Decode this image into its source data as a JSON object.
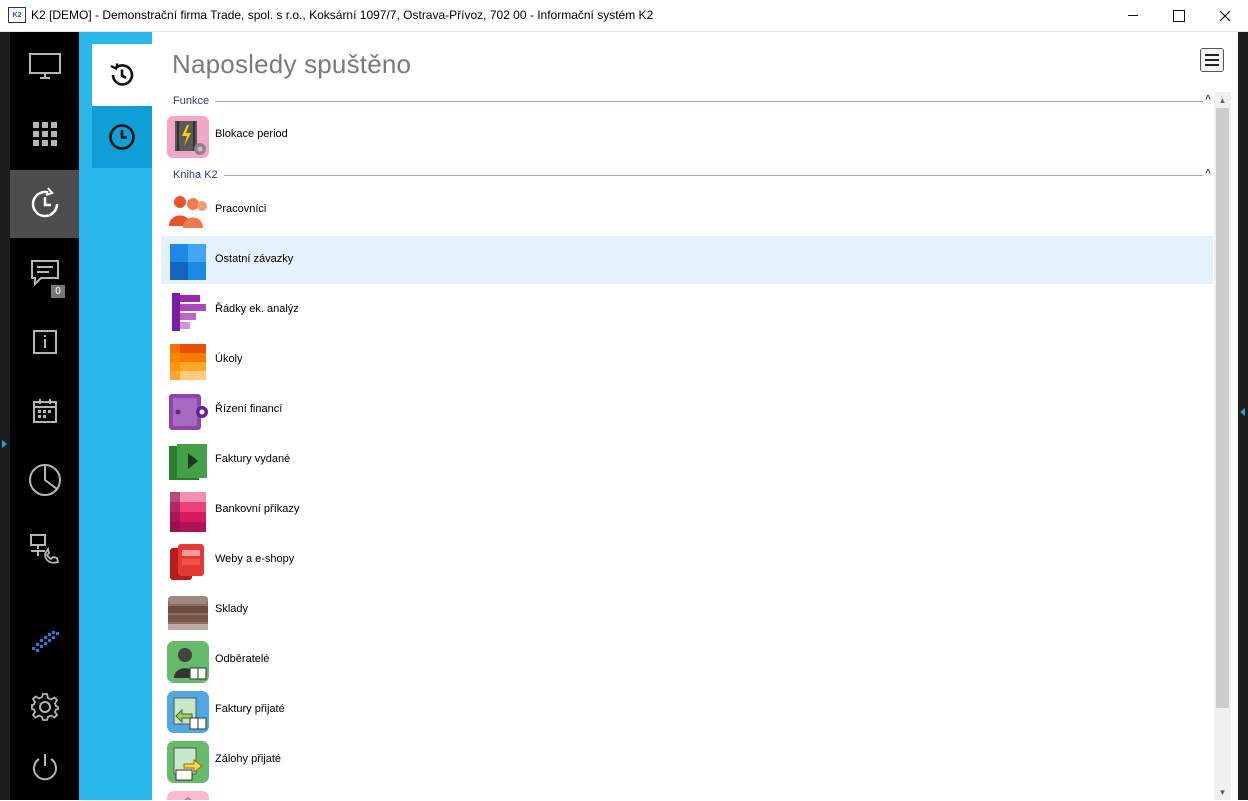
{
  "window": {
    "icon_text": "K2",
    "title": "K2 [DEMO] - Demonstrační firma Trade, spol. s r.o., Koksární 1097/7, Ostrava-Přívoz, 702 00 - Informační systém K2"
  },
  "sidebar": {
    "items": [
      {
        "icon": "monitor-icon"
      },
      {
        "icon": "grid-icon"
      },
      {
        "icon": "recent-icon",
        "active": true
      },
      {
        "icon": "messages-icon",
        "badge": "0"
      },
      {
        "icon": "info-icon"
      },
      {
        "icon": "calendar-icon"
      },
      {
        "icon": "pie-chart-icon"
      },
      {
        "icon": "network-phone-icon"
      },
      {
        "icon": "k2-logo-icon"
      },
      {
        "icon": "gear-icon"
      },
      {
        "icon": "power-icon"
      }
    ]
  },
  "tabs": [
    {
      "icon": "history-icon",
      "active": true
    },
    {
      "icon": "clock-icon"
    }
  ],
  "main": {
    "title": "Naposledy spuštěno",
    "groups": [
      {
        "label": "Funkce",
        "items": [
          {
            "label": "Blokace period",
            "icon": "blokace-icon"
          }
        ]
      },
      {
        "label": "Kniha K2",
        "items": [
          {
            "label": "Pracovníci",
            "icon": "people-icon"
          },
          {
            "label": "Ostatní závazky",
            "icon": "liabilities-icon",
            "selected": true
          },
          {
            "label": "Řádky ek. analýz",
            "icon": "analysis-icon"
          },
          {
            "label": "Úkoly",
            "icon": "tasks-icon"
          },
          {
            "label": "Řízení financí",
            "icon": "finance-icon"
          },
          {
            "label": "Faktury vydané",
            "icon": "invoices-issued-icon"
          },
          {
            "label": "Bankovní příkazy",
            "icon": "bank-orders-icon"
          },
          {
            "label": "Weby a e-shopy",
            "icon": "web-shop-icon"
          },
          {
            "label": "Sklady",
            "icon": "warehouse-icon"
          },
          {
            "label": "Odběratelé",
            "icon": "customers-icon"
          },
          {
            "label": "Faktury přijaté",
            "icon": "invoices-received-icon"
          },
          {
            "label": "Zálohy přijaté",
            "icon": "advances-received-icon"
          }
        ]
      }
    ]
  },
  "colors": {
    "sidebar_bg": "#000000",
    "accent_blue": "#29b6e8",
    "selected_row": "#e5f1fb",
    "group_text": "#2a3a8c"
  }
}
